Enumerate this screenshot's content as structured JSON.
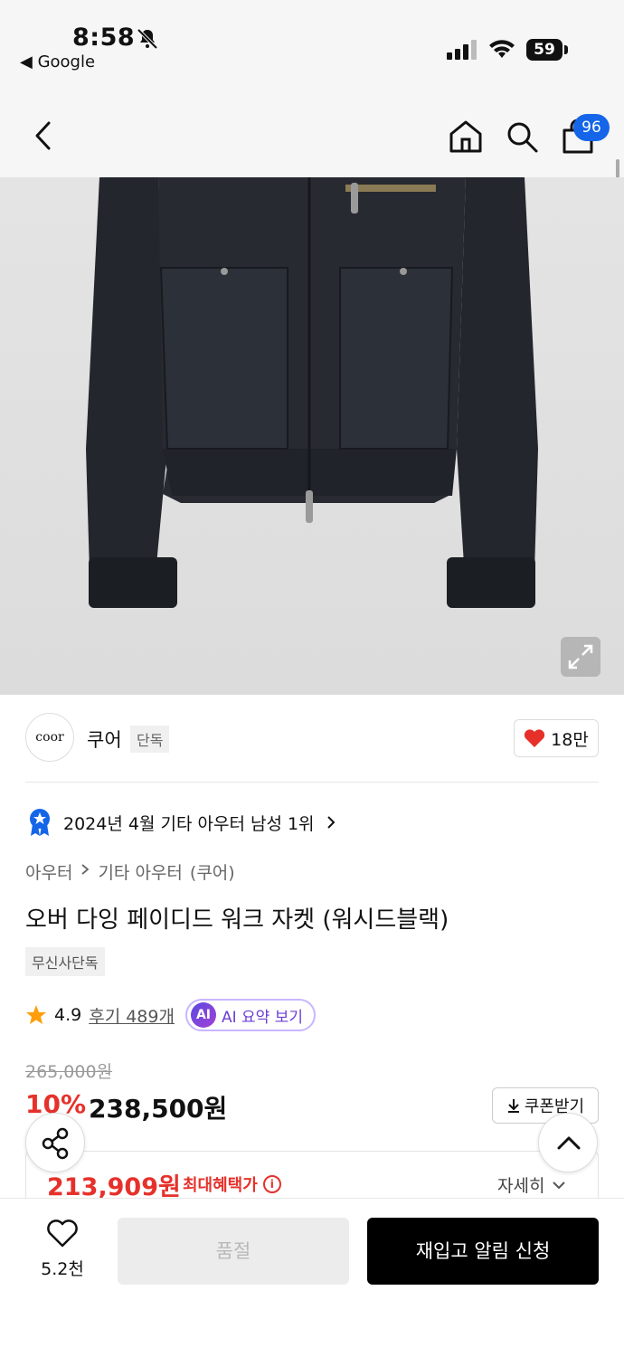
{
  "status_bar": {
    "time": "8:58",
    "back_app": "◀ Google",
    "battery": "59"
  },
  "header": {
    "cart_count": "96"
  },
  "brand": {
    "logo_text": "coor",
    "name": "쿠어",
    "exclusive_tag": "단독",
    "like_count": "18만"
  },
  "ranking": {
    "text": "2024년 4월 기타 아우터 남성 1위"
  },
  "breadcrumb": {
    "category": "아우터",
    "subcategory": "기타 아우터",
    "brand": "(쿠어)"
  },
  "product": {
    "title": "오버 다잉 페이디드 워크 자켓 (워시드블랙)",
    "tag": "무신사단독",
    "rating": "4.9",
    "review_text": "후기 489개",
    "ai_badge": "AI",
    "ai_label": "AI 요약 보기"
  },
  "price": {
    "original": "265,000원",
    "discount_rate": "10%",
    "sale_price": "238,500원",
    "coupon_label": "쿠폰받기",
    "max_benefit_price": "213,909원",
    "max_benefit_label": "최대혜택가",
    "detail_label": "자세히"
  },
  "bottom_bar": {
    "wish_count": "5.2천",
    "soldout_label": "품절",
    "restock_label": "재입고 알림 신청"
  },
  "colors": {
    "accent_red": "#e6312b",
    "badge_blue": "#1565e8",
    "ai_purple": "#6b3fd4"
  }
}
